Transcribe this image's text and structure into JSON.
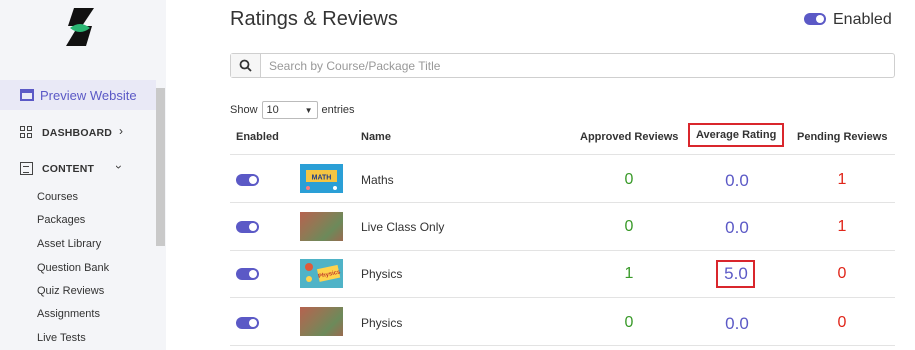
{
  "sidebar": {
    "preview": "Preview Website",
    "dashboard": "DASHBOARD",
    "content": "CONTENT",
    "sub_items": [
      "Courses",
      "Packages",
      "Asset Library",
      "Question Bank",
      "Quiz Reviews",
      "Assignments",
      "Live Tests"
    ]
  },
  "page": {
    "title": "Ratings & Reviews",
    "enabled_label": "Enabled"
  },
  "search": {
    "placeholder": "Search by Course/Package Title"
  },
  "entries": {
    "show": "Show",
    "value": "10",
    "suffix": "entries"
  },
  "table": {
    "headers": [
      "Enabled",
      "Name",
      "Approved Reviews",
      "Average Rating",
      "Pending Reviews"
    ],
    "rows": [
      {
        "name": "Maths",
        "approved": "0",
        "rating": "0.0",
        "pending": "1",
        "thumb_label": "MATH"
      },
      {
        "name": "Live Class Only",
        "approved": "0",
        "rating": "0.0",
        "pending": "1",
        "thumb_label": ""
      },
      {
        "name": "Physics",
        "approved": "1",
        "rating": "5.0",
        "pending": "0",
        "thumb_label": "Physics"
      },
      {
        "name": "Physics",
        "approved": "0",
        "rating": "0.0",
        "pending": "0",
        "thumb_label": ""
      }
    ]
  },
  "colors": {
    "accent": "#5b59c6",
    "approved": "#3a9a2a",
    "pending": "#e0261a",
    "highlight": "#d9262c"
  }
}
